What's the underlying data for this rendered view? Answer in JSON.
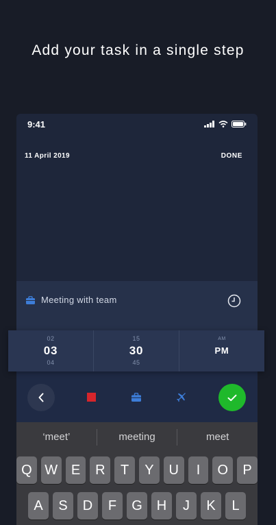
{
  "headline": "Add your task in a single step",
  "status_bar": {
    "time": "9:41"
  },
  "header": {
    "date": "11 April 2019",
    "done_label": "DONE"
  },
  "task": {
    "value": "Meeting with team",
    "category_icon": "briefcase-icon",
    "category_color": "#3d7dd8"
  },
  "time_picker": {
    "hour": {
      "prev": "02",
      "selected": "03",
      "next": "04"
    },
    "minute": {
      "prev": "15",
      "selected": "30",
      "next": "45"
    },
    "period": {
      "prev": "AM",
      "selected": "PM"
    }
  },
  "toolbar": {
    "colors": {
      "red": "#d6252b",
      "blue": "#3d7dd8",
      "confirm": "#1fb92b"
    },
    "icons": [
      "chevron-left-icon",
      "red-square-icon",
      "briefcase-icon",
      "airplane-icon",
      "checkmark-icon"
    ]
  },
  "keyboard": {
    "suggestions": [
      "‘meet’",
      "meeting",
      "meet"
    ],
    "row1": [
      "Q",
      "W",
      "E",
      "R",
      "T",
      "Y",
      "U",
      "I",
      "O",
      "P"
    ],
    "row2": [
      "A",
      "S",
      "D",
      "F",
      "G",
      "H",
      "J",
      "K",
      "L"
    ]
  }
}
